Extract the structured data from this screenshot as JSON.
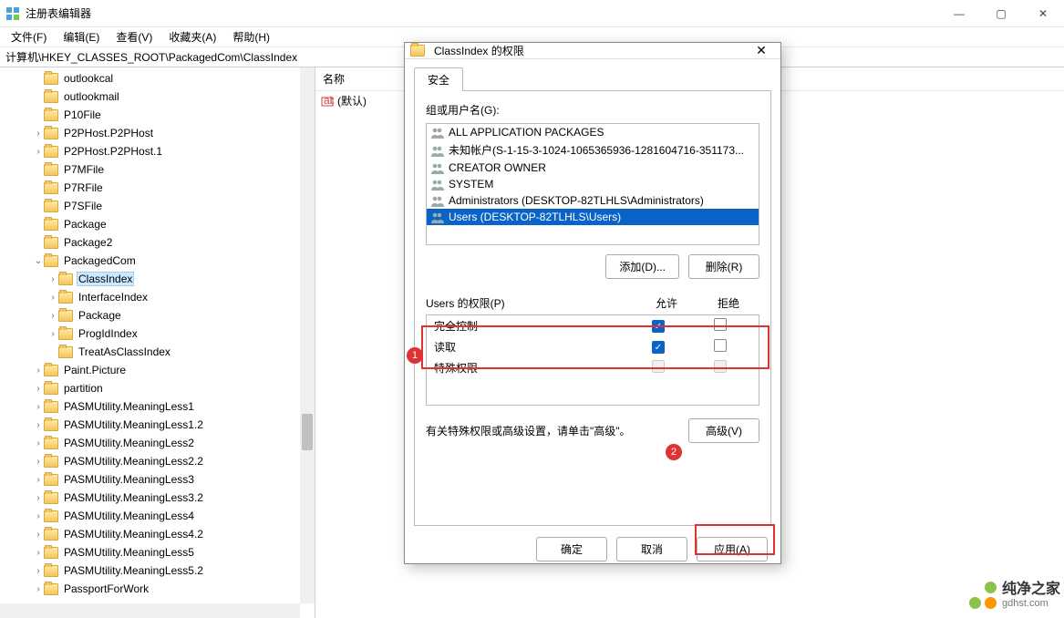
{
  "window": {
    "title": "注册表编辑器",
    "menus": [
      "文件(F)",
      "编辑(E)",
      "查看(V)",
      "收藏夹(A)",
      "帮助(H)"
    ],
    "address": "计算机\\HKEY_CLASSES_ROOT\\PackagedCom\\ClassIndex",
    "win_min": "—",
    "win_max": "▢",
    "win_close": "✕"
  },
  "tree": [
    {
      "indent": 2,
      "exp": "",
      "label": "outlookcal"
    },
    {
      "indent": 2,
      "exp": "",
      "label": "outlookmail"
    },
    {
      "indent": 2,
      "exp": "",
      "label": "P10File"
    },
    {
      "indent": 2,
      "exp": ">",
      "label": "P2PHost.P2PHost"
    },
    {
      "indent": 2,
      "exp": ">",
      "label": "P2PHost.P2PHost.1"
    },
    {
      "indent": 2,
      "exp": "",
      "label": "P7MFile"
    },
    {
      "indent": 2,
      "exp": "",
      "label": "P7RFile"
    },
    {
      "indent": 2,
      "exp": "",
      "label": "P7SFile"
    },
    {
      "indent": 2,
      "exp": "",
      "label": "Package"
    },
    {
      "indent": 2,
      "exp": "",
      "label": "Package2"
    },
    {
      "indent": 2,
      "exp": "v",
      "label": "PackagedCom"
    },
    {
      "indent": 3,
      "exp": ">",
      "label": "ClassIndex",
      "selected": true
    },
    {
      "indent": 3,
      "exp": ">",
      "label": "InterfaceIndex"
    },
    {
      "indent": 3,
      "exp": ">",
      "label": "Package"
    },
    {
      "indent": 3,
      "exp": ">",
      "label": "ProgIdIndex"
    },
    {
      "indent": 3,
      "exp": "",
      "label": "TreatAsClassIndex"
    },
    {
      "indent": 2,
      "exp": ">",
      "label": "Paint.Picture"
    },
    {
      "indent": 2,
      "exp": ">",
      "label": "partition"
    },
    {
      "indent": 2,
      "exp": ">",
      "label": "PASMUtility.MeaningLess1"
    },
    {
      "indent": 2,
      "exp": ">",
      "label": "PASMUtility.MeaningLess1.2"
    },
    {
      "indent": 2,
      "exp": ">",
      "label": "PASMUtility.MeaningLess2"
    },
    {
      "indent": 2,
      "exp": ">",
      "label": "PASMUtility.MeaningLess2.2"
    },
    {
      "indent": 2,
      "exp": ">",
      "label": "PASMUtility.MeaningLess3"
    },
    {
      "indent": 2,
      "exp": ">",
      "label": "PASMUtility.MeaningLess3.2"
    },
    {
      "indent": 2,
      "exp": ">",
      "label": "PASMUtility.MeaningLess4"
    },
    {
      "indent": 2,
      "exp": ">",
      "label": "PASMUtility.MeaningLess4.2"
    },
    {
      "indent": 2,
      "exp": ">",
      "label": "PASMUtility.MeaningLess5"
    },
    {
      "indent": 2,
      "exp": ">",
      "label": "PASMUtility.MeaningLess5.2"
    },
    {
      "indent": 2,
      "exp": ">",
      "label": "PassportForWork"
    }
  ],
  "list": {
    "col_name": "名称",
    "default_value": "(默认)"
  },
  "dialog": {
    "title": "ClassIndex 的权限",
    "tab_security": "安全",
    "groups_label": "组或用户名(G):",
    "groups": [
      "ALL APPLICATION PACKAGES",
      "未知帐户(S-1-15-3-1024-1065365936-1281604716-35117​3...",
      "CREATOR OWNER",
      "SYSTEM",
      "Administrators (DESKTOP-82TLHLS\\Administrators)",
      "Users (DESKTOP-82TLHLS\\Users)"
    ],
    "selected_group_index": 5,
    "add_btn": "添加(D)...",
    "remove_btn": "删除(R)",
    "perm_title": "Users 的权限(P)",
    "allow_hdr": "允许",
    "deny_hdr": "拒绝",
    "perms": [
      {
        "label": "完全控制",
        "allow": true,
        "deny": false
      },
      {
        "label": "读取",
        "allow": true,
        "deny": false
      },
      {
        "label": "特殊权限",
        "allow": false,
        "deny": false,
        "disabled": true
      }
    ],
    "adv_text": "有关特殊权限或高级设置，请单击\"高级\"。",
    "adv_btn": "高级(V)",
    "ok": "确定",
    "cancel": "取消",
    "apply": "应用(A)"
  },
  "annotations": {
    "badge1": "1",
    "badge2": "2"
  },
  "watermark": {
    "cn": "纯净之家",
    "url": "gdhst.com"
  }
}
